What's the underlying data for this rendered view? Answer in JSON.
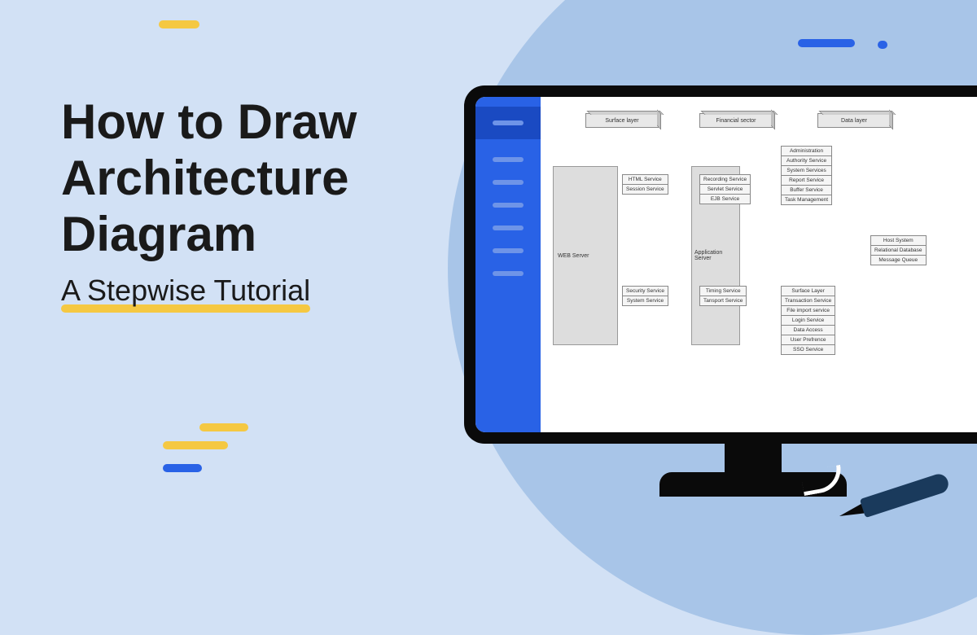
{
  "title_lines": [
    "How to Draw",
    "Architecture",
    "Diagram"
  ],
  "subtitle": "A Stepwise Tutorial",
  "diagram": {
    "top_layers": [
      "Surface layer",
      "Financial sector",
      "Data layer"
    ],
    "web_server_label": "WEB Server",
    "app_server_label": "Application Server",
    "col1_top": [
      "HTML Service",
      "Session Service"
    ],
    "col1_bottom": [
      "Security Service",
      "System Service"
    ],
    "col2_top": [
      "Recording Service",
      "Servlet Service",
      "EJB Service"
    ],
    "col2_bottom": [
      "Timing Service",
      "Tansport Service"
    ],
    "col3_top": [
      "Administration",
      "Authority Service",
      "System Services",
      "Report Service",
      "Buffer Service",
      "Task Management"
    ],
    "col3_bottom": [
      "Surface Layer",
      "Transaction Service",
      "File import service",
      "Login Service",
      "Data Access",
      "User Prefrence",
      "SSO Service"
    ],
    "col4": [
      "Host System",
      "Relational Database",
      "Message Queue"
    ]
  }
}
